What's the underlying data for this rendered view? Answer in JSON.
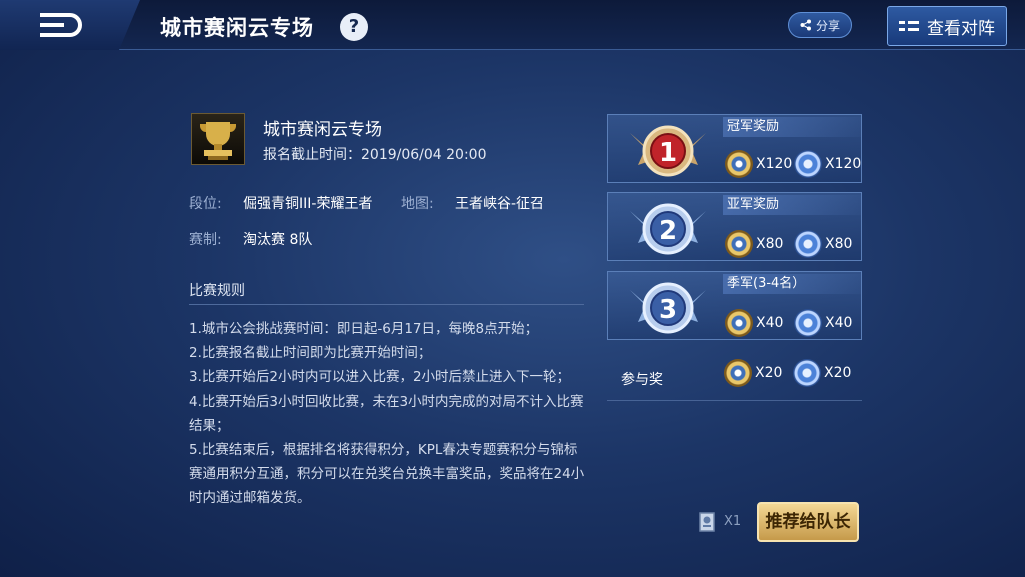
{
  "header": {
    "title": "城市赛闲云专场",
    "help_label": "?",
    "share_label": "分享",
    "lineup_label": "查看对阵"
  },
  "match": {
    "name": "城市赛闲云专场",
    "deadline": "报名截止时间：2019/06/04 20:00",
    "tier_label": "段位:",
    "tier_value": "倔强青铜III-荣耀王者",
    "map_label": "地图:",
    "map_value": "王者峡谷-征召",
    "format_label": "赛制:",
    "format_value": "淘汰赛 8队"
  },
  "rules": {
    "title": "比赛规则",
    "lines": [
      "1.城市公会挑战赛时间：即日起-6月17日，每晚8点开始；",
      "2.比赛报名截止时间即为比赛开始时间；",
      "3.比赛开始后2小时内可以进入比赛，2小时后禁止进入下一轮；",
      "4.比赛开始后3小时回收比赛，未在3小时内完成的对局不计入比赛结果；",
      "5.比赛结束后，根据排名将获得积分，KPL春决专题赛积分与锦标赛通用积分互通，积分可以在兑奖台兑换丰富奖品，奖品将在24小时内通过邮箱发货。"
    ]
  },
  "rewards": [
    {
      "rank": "1",
      "title": "冠军奖励",
      "qty_a": "X120",
      "qty_b": "X120"
    },
    {
      "rank": "2",
      "title": "亚军奖励",
      "qty_a": "X80",
      "qty_b": "X80"
    },
    {
      "rank": "3",
      "title": "季军(3-4名）",
      "qty_a": "X40",
      "qty_b": "X40"
    }
  ],
  "participation": {
    "label": "参与奖",
    "qty_a": "X20",
    "qty_b": "X20"
  },
  "footer": {
    "ticket_qty": "X1",
    "recommend_label": "推荐给队长"
  },
  "colors": {
    "background": "#1c3566",
    "gold_button": "#e6c57a",
    "accent_blue": "#2e5aa2"
  },
  "icons": [
    "back-icon",
    "help-icon",
    "share-icon",
    "lineup-icon",
    "trophy-icon",
    "gold-coin-icon",
    "blue-coin-icon",
    "ticket-icon"
  ]
}
